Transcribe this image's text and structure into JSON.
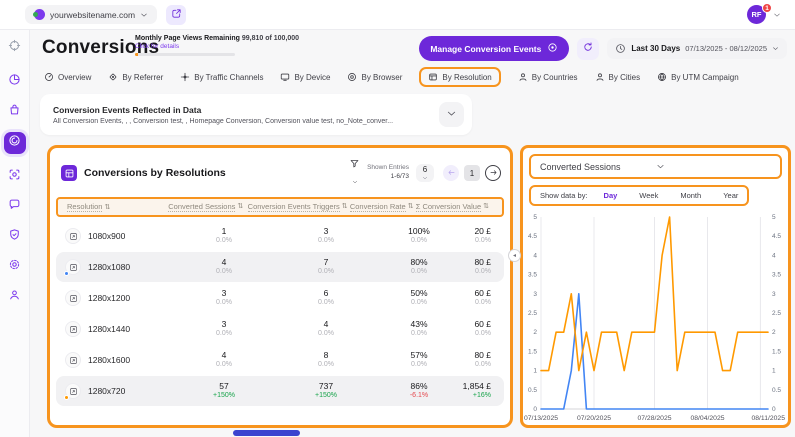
{
  "colors": {
    "accent_purple": "#6d28d9",
    "highlight_orange": "#f7941e",
    "chart_orange": "#ff9900",
    "chart_blue": "#4285f4",
    "positive_green": "#17a34a",
    "negative_red": "#e5484d"
  },
  "topbar": {
    "site_name": "yourwebsitename.com",
    "avatar_initials": "RF",
    "notification_count": "1"
  },
  "header": {
    "title": "Conversions",
    "page_views_label": "Monthly Page Views Remaining",
    "page_views_value": "99,810 of 100,000",
    "details_link": "Click for details",
    "manage_button": "Manage Conversion Events",
    "date_range_label": "Last 30 Days",
    "date_range_value": "07/13/2025 - 08/12/2025"
  },
  "tabs": [
    {
      "label": "Overview",
      "icon": "gauge-icon",
      "highlighted": false
    },
    {
      "label": "By Referrer",
      "icon": "referrer-icon",
      "highlighted": false
    },
    {
      "label": "By Traffic Channels",
      "icon": "traffic-channels-icon",
      "highlighted": false
    },
    {
      "label": "By Device",
      "icon": "device-icon",
      "highlighted": false
    },
    {
      "label": "By Browser",
      "icon": "browser-icon",
      "highlighted": false
    },
    {
      "label": "By Resolution",
      "icon": "resolution-icon",
      "highlighted": true
    },
    {
      "label": "By Countries",
      "icon": "person-icon",
      "highlighted": false
    },
    {
      "label": "By Cities",
      "icon": "person-icon",
      "highlighted": false
    },
    {
      "label": "By UTM Campaign",
      "icon": "globe-icon",
      "highlighted": false
    }
  ],
  "sidebar": {
    "items": [
      {
        "icon": "crosshair-icon",
        "state": "muted"
      },
      {
        "icon": "analytics-icon",
        "state": "normal"
      },
      {
        "icon": "shop-bag-icon",
        "state": "normal"
      },
      {
        "icon": "conversions-spiral-icon",
        "state": "active"
      },
      {
        "icon": "face-scan-icon",
        "state": "normal"
      },
      {
        "icon": "chat-icon",
        "state": "normal"
      },
      {
        "icon": "shield-check-icon",
        "state": "normal"
      },
      {
        "icon": "settings-gear-icon",
        "state": "normal"
      },
      {
        "icon": "support-person-icon",
        "state": "normal"
      }
    ]
  },
  "events_filter": {
    "title": "Conversion Events Reflected in Data",
    "subtitle": "All Conversion Events, , , Conversion test, , Homepage Conversion, Conversion value test, no_Note_conver..."
  },
  "table": {
    "title": "Conversions by Resolutions",
    "shown_entries_label": "Shown Entries",
    "shown_entries_value": "1-6/73",
    "page_size": "6",
    "current_page": "1",
    "columns": [
      "Resolution",
      "Converted Sessions",
      "Conversion Events Triggers",
      "Conversion Rate",
      "Σ Conversion Value"
    ],
    "rows": [
      {
        "resolution": "1080x900",
        "dot": null,
        "highlight": false,
        "cells": [
          [
            "1",
            "0.0%",
            "n"
          ],
          [
            "3",
            "0.0%",
            "n"
          ],
          [
            "100%",
            "0.0%",
            "n"
          ],
          [
            "20 £",
            "0.0%",
            "n"
          ]
        ]
      },
      {
        "resolution": "1280x1080",
        "dot": "#4285f4",
        "highlight": true,
        "cells": [
          [
            "4",
            "0.0%",
            "n"
          ],
          [
            "7",
            "0.0%",
            "n"
          ],
          [
            "80%",
            "0.0%",
            "n"
          ],
          [
            "80 £",
            "0.0%",
            "n"
          ]
        ]
      },
      {
        "resolution": "1280x1200",
        "dot": null,
        "highlight": false,
        "cells": [
          [
            "3",
            "0.0%",
            "n"
          ],
          [
            "6",
            "0.0%",
            "n"
          ],
          [
            "50%",
            "0.0%",
            "n"
          ],
          [
            "60 £",
            "0.0%",
            "n"
          ]
        ]
      },
      {
        "resolution": "1280x1440",
        "dot": null,
        "highlight": false,
        "cells": [
          [
            "3",
            "0.0%",
            "n"
          ],
          [
            "4",
            "0.0%",
            "n"
          ],
          [
            "43%",
            "0.0%",
            "n"
          ],
          [
            "60 £",
            "0.0%",
            "n"
          ]
        ]
      },
      {
        "resolution": "1280x1600",
        "dot": null,
        "highlight": false,
        "cells": [
          [
            "4",
            "0.0%",
            "n"
          ],
          [
            "8",
            "0.0%",
            "n"
          ],
          [
            "57%",
            "0.0%",
            "n"
          ],
          [
            "80 £",
            "0.0%",
            "n"
          ]
        ]
      },
      {
        "resolution": "1280x720",
        "dot": "#ff9900",
        "highlight": true,
        "cells": [
          [
            "57",
            "+150%",
            "up"
          ],
          [
            "737",
            "+150%",
            "up"
          ],
          [
            "86%",
            "-6.1%",
            "down"
          ],
          [
            "1,854 £",
            "+16%",
            "up"
          ]
        ]
      }
    ]
  },
  "panel": {
    "metric_selector": "Converted Sessions",
    "show_data_by_label": "Show data by:",
    "periods": [
      "Day",
      "Week",
      "Month",
      "Year"
    ],
    "active_period": "Day"
  },
  "chart_data": {
    "type": "line",
    "title": "Converted Sessions",
    "xlabel": "",
    "ylabel": "",
    "ylim": [
      0,
      5
    ],
    "y_tick_step": 0.5,
    "grid": "vertical",
    "legend": "none",
    "x_range": [
      "07/13/2025",
      "08/12/2025"
    ],
    "x_tick_labels": [
      "07/13/2025",
      "07/20/2025",
      "07/28/2025",
      "08/04/2025",
      "08/11/2025"
    ],
    "x_tick_indices": [
      0,
      7,
      15,
      22,
      29
    ],
    "series": [
      {
        "name": "1280x720",
        "color": "#ff9900",
        "values": [
          1,
          1,
          2,
          2,
          3,
          1,
          2,
          1,
          2,
          2,
          2,
          1,
          2,
          2,
          2,
          2,
          4,
          5,
          1,
          2,
          2,
          2,
          2,
          2,
          1,
          1,
          2,
          2,
          2,
          2,
          2
        ]
      },
      {
        "name": "1280x1080",
        "color": "#4285f4",
        "values": [
          0,
          0,
          0,
          0,
          1,
          3,
          0,
          0,
          0,
          0,
          0,
          0,
          0,
          0,
          0,
          0,
          0,
          0,
          0,
          0,
          0,
          0,
          0,
          0,
          0,
          0,
          0,
          0,
          0,
          0,
          0
        ]
      }
    ]
  }
}
